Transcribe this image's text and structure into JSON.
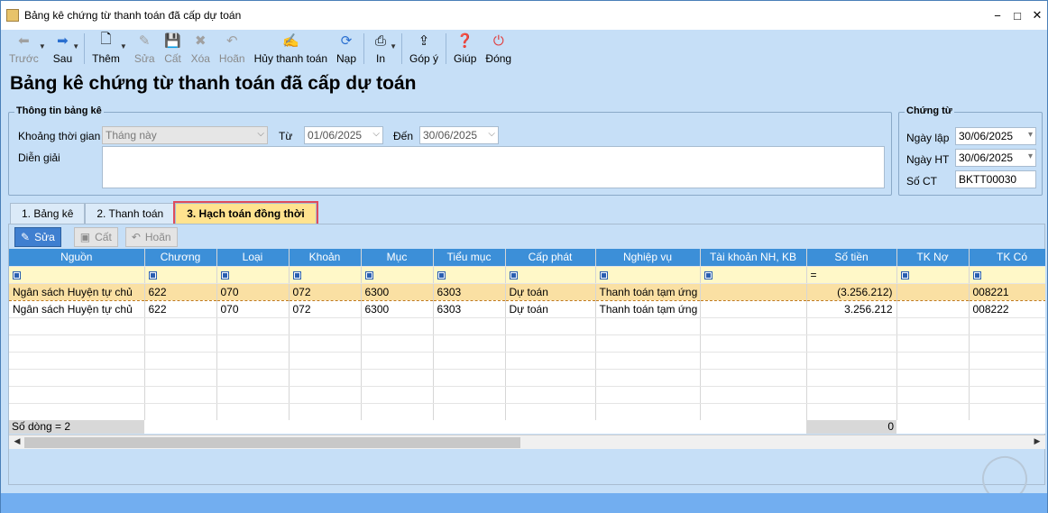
{
  "window": {
    "title": "Bảng kê chứng từ thanh toán đã cấp dự toán",
    "minimize_label": "−",
    "maximize_label": "□",
    "close_label": "✕"
  },
  "toolbar": {
    "prev_label": "Trước",
    "next_label": "Sau",
    "add_label": "Thêm",
    "edit_label": "Sửa",
    "cut_label": "Cất",
    "delete_label": "Xóa",
    "undo_label": "Hoãn",
    "cancel_payment_label": "Hủy thanh toán",
    "reload_label": "Nạp",
    "print_label": "In",
    "feedback_label": "Góp ý",
    "help_label": "Giúp",
    "close_label": "Đóng"
  },
  "page": {
    "title": "Bảng kê chứng từ thanh toán đã cấp dự toán"
  },
  "info_group": {
    "title": "Thông tin bảng kê",
    "period_label": "Khoảng thời gian",
    "period_value": "Tháng này",
    "from_label": "Từ",
    "from_value": "01/06/2025",
    "to_label": "Đến",
    "to_value": "30/06/2025",
    "desc_label": "Diễn giải",
    "desc_value": ""
  },
  "voucher_group": {
    "title": "Chứng từ",
    "created_label": "Ngày lập",
    "created_value": "30/06/2025",
    "posted_label": "Ngày HT",
    "posted_value": "30/06/2025",
    "number_label": "Số CT",
    "number_value": "BKTT00030"
  },
  "tabs": [
    {
      "label": "1. Bảng kê"
    },
    {
      "label": "2. Thanh toán"
    },
    {
      "label": "3. Hạch toán đồng thời"
    }
  ],
  "subtoolbar": {
    "edit_label": "Sửa",
    "cut_label": "Cất",
    "undo_label": "Hoãn"
  },
  "grid": {
    "columns": [
      "Nguồn",
      "Chương",
      "Loại",
      "Khoản",
      "Mục",
      "Tiểu mục",
      "Cấp phát",
      "Nghiệp vụ",
      "Tài khoản NH, KB",
      "Số tiền",
      "TK Nợ",
      "TK Có"
    ],
    "amount_filter_symbol": "=",
    "rows": [
      [
        "Ngân sách Huyện tự chủ",
        "622",
        "070",
        "072",
        "6300",
        "6303",
        "Dự toán",
        "Thanh toán tạm ứng",
        "",
        "(3.256.212)",
        "",
        "008221"
      ],
      [
        "Ngân sách Huyện tự chủ",
        "622",
        "070",
        "072",
        "6300",
        "6303",
        "Dự toán",
        "Thanh toán tạm ứng",
        "",
        "3.256.212",
        "",
        "008222"
      ]
    ],
    "row_count_label": "Số dòng = 2",
    "total_amount": "0"
  },
  "watermark": "DỮ LIỆU MẪU"
}
